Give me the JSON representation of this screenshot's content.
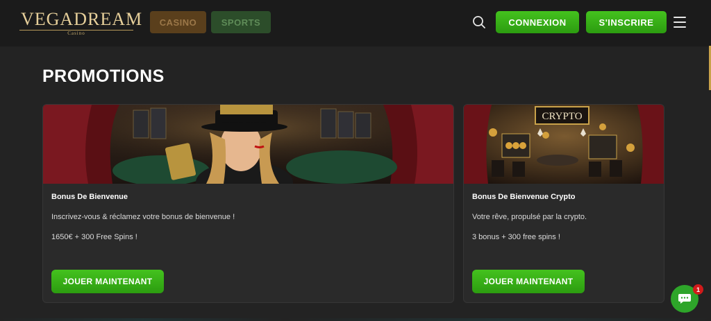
{
  "header": {
    "logo_text": "VEGADREAM",
    "logo_sub": "Casino",
    "tabs": [
      {
        "label": "CASINO"
      },
      {
        "label": "SPORTS"
      }
    ],
    "login_label": "CONNEXION",
    "signup_label": "S'INSCRIRE",
    "search_icon": "search-icon",
    "menu_icon": "hamburger-menu-icon"
  },
  "main": {
    "title": "PROMOTIONS",
    "cards": [
      {
        "image_badge": "",
        "title": "Bonus De Bienvenue",
        "description": "Inscrivez-vous & réclamez votre bonus de bienvenue !",
        "offer": "1650€ + 300 Free Spins !",
        "button_label": "JOUER MAINTENANT"
      },
      {
        "image_badge": "CRYPTO",
        "title": "Bonus De Bienvenue Crypto",
        "description": "Votre rêve, propulsé par la crypto.",
        "offer": "3 bonus + 300 free spins !",
        "button_label": "JOUER MAINTENANT"
      }
    ]
  },
  "chat": {
    "icon": "chat-bubble-icon",
    "badge_count": "1"
  },
  "colors": {
    "accent_green": "#38b018",
    "background": "#232323",
    "header_bg": "#1b1b1b",
    "gold": "#e6cf9a"
  }
}
